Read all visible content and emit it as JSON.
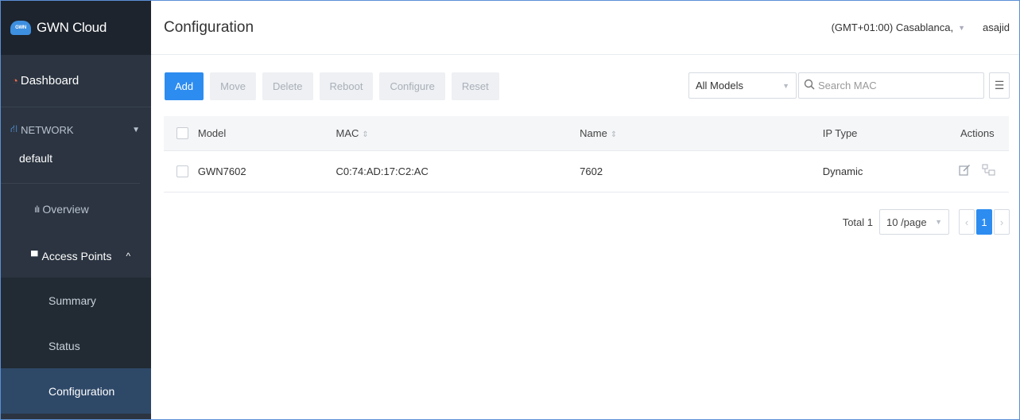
{
  "sidebar": {
    "brand": "GWN Cloud",
    "logo_text": "GWN",
    "dashboard": "Dashboard",
    "network": "NETWORK",
    "network_name": "default",
    "overview": "Overview",
    "access_points": "Access Points",
    "sub_items": [
      "Summary",
      "Status",
      "Configuration"
    ]
  },
  "header": {
    "title": "Configuration",
    "timezone": "(GMT+01:00) Casablanca,",
    "user": "asajid"
  },
  "toolbar": {
    "add": "Add",
    "move": "Move",
    "delete": "Delete",
    "reboot": "Reboot",
    "configure": "Configure",
    "reset": "Reset"
  },
  "filters": {
    "model_select": "All Models",
    "search_placeholder": "Search MAC"
  },
  "table": {
    "headers": {
      "model": "Model",
      "mac": "MAC",
      "name": "Name",
      "ip_type": "IP Type",
      "actions": "Actions"
    },
    "rows": [
      {
        "model": "GWN7602",
        "mac": "C0:74:AD:17:C2:AC",
        "name": "7602",
        "ip_type": "Dynamic"
      }
    ]
  },
  "pagination": {
    "total": "Total 1",
    "per_page": "10 /page",
    "current_page": "1"
  },
  "colors": {
    "accent": "#2d8cf0",
    "sidebar_bg": "#2b3440",
    "active_item_bg": "#2e4868"
  }
}
